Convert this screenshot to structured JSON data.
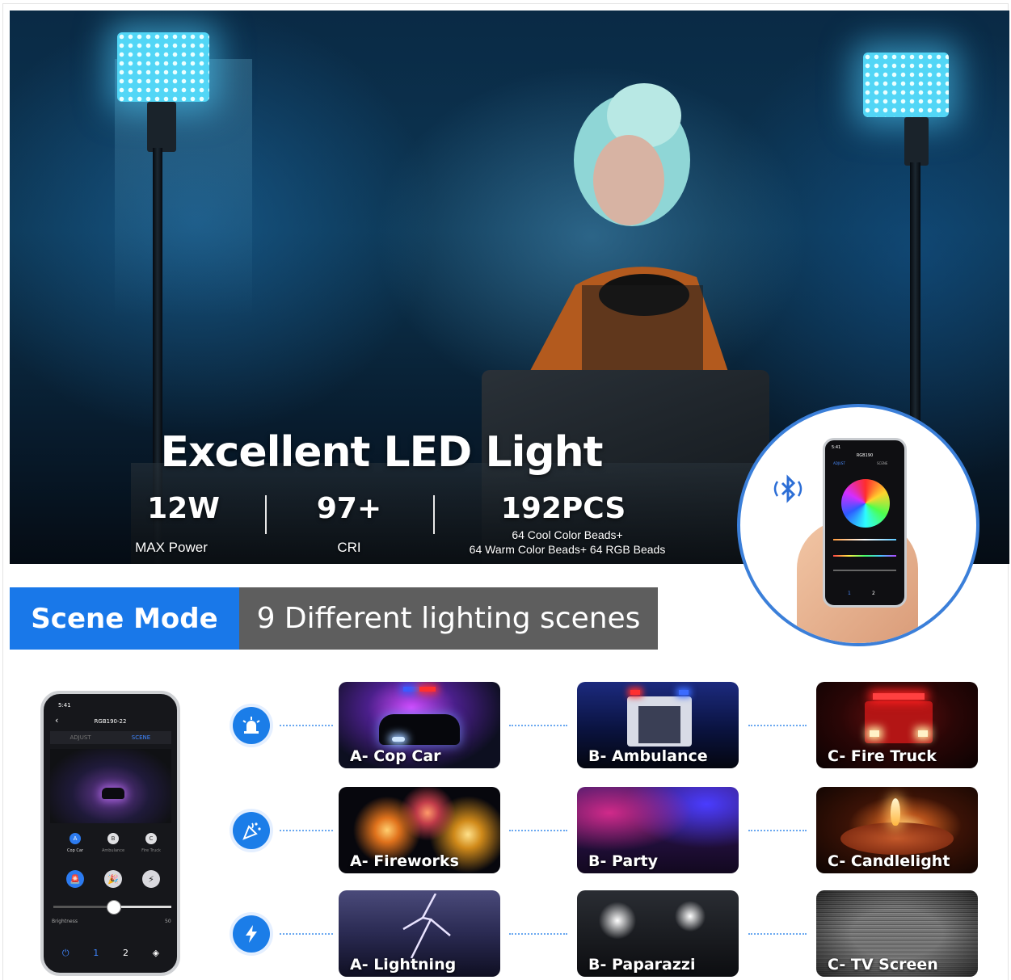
{
  "hero": {
    "title": "Excellent LED Light",
    "stats": [
      {
        "value": "12W",
        "label": "MAX Power"
      },
      {
        "value": "97+",
        "label": "CRI"
      },
      {
        "value": "192PCS",
        "label_line1": "64 Cool Color Beads+",
        "label_line2": "64 Warm Color Beads+ 64 RGB Beads"
      }
    ],
    "colors": {
      "panel_glow": "#52d6f6",
      "accent_border": "#3b7fd9"
    }
  },
  "app_preview": {
    "small_phone": {
      "time": "5:41",
      "title": "RGB190",
      "tab_adjust": "ADJUST",
      "tab_scene": "SCENE",
      "nav": [
        "1",
        "2"
      ]
    },
    "icon": "bluetooth-icon"
  },
  "scene_mode": {
    "tag": "Scene Mode",
    "description": "9 Different lighting scenes",
    "colors": {
      "tag_bg": "#1978e9",
      "desc_bg": "#5e5e5e"
    }
  },
  "phone": {
    "time": "5:41",
    "title": "RGB190-22",
    "tab_adjust": "ADJUST",
    "tab_scene": "SCENE",
    "abc": [
      "A",
      "B",
      "C"
    ],
    "abc_labels": [
      "Cop Car",
      "Ambulance",
      "Fire Truck"
    ],
    "brightness_label": "Brightness",
    "brightness_value": "50",
    "brightness_level": 0.5,
    "bottom_nav": [
      "1",
      "2"
    ]
  },
  "scene_groups": [
    {
      "icon": "siren-icon",
      "scenes": [
        "A- Cop Car",
        "B- Ambulance",
        "C- Fire Truck"
      ]
    },
    {
      "icon": "party-popper-icon",
      "scenes": [
        "A- Fireworks",
        "B- Party",
        "C- Candlelight"
      ]
    },
    {
      "icon": "lightning-icon",
      "scenes": [
        "A- Lightning",
        "B- Paparazzi",
        "C- TV Screen"
      ]
    }
  ]
}
